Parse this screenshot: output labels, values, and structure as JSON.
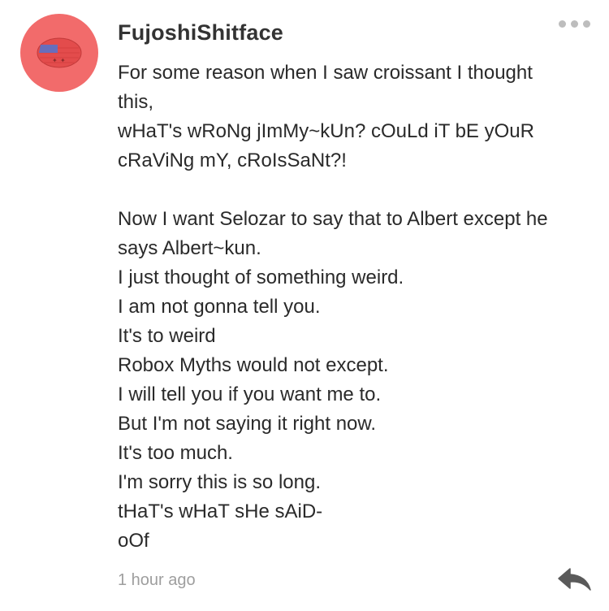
{
  "comment": {
    "username": "FujoshiShitface",
    "avatar": {
      "background_color": "#f26b6b",
      "icon": "flag-badge-icon"
    },
    "more_icon": "more-dots-icon",
    "lines": [
      "For some reason when I saw croissant I thought",
      "this,",
      "wHaT's wRoNg jImMy~kUn? cOuLd iT bE yOuR",
      "cRaViNg mY, cRoIsSaNt?!",
      "",
      "Now I want Selozar to say that to Albert except he",
      "says Albert~kun.",
      "I just thought of something weird.",
      "I am not gonna tell you.",
      "It's to weird",
      "Robox Myths would not except.",
      "I will tell you if you want me to.",
      "But I'm not saying it right now.",
      "It's too much.",
      "I'm sorry this is so long.",
      "tHaT's wHaT sHe sAiD-",
      "oOf"
    ],
    "timestamp": "1 hour ago",
    "reply_icon": "reply-arrow-icon"
  }
}
